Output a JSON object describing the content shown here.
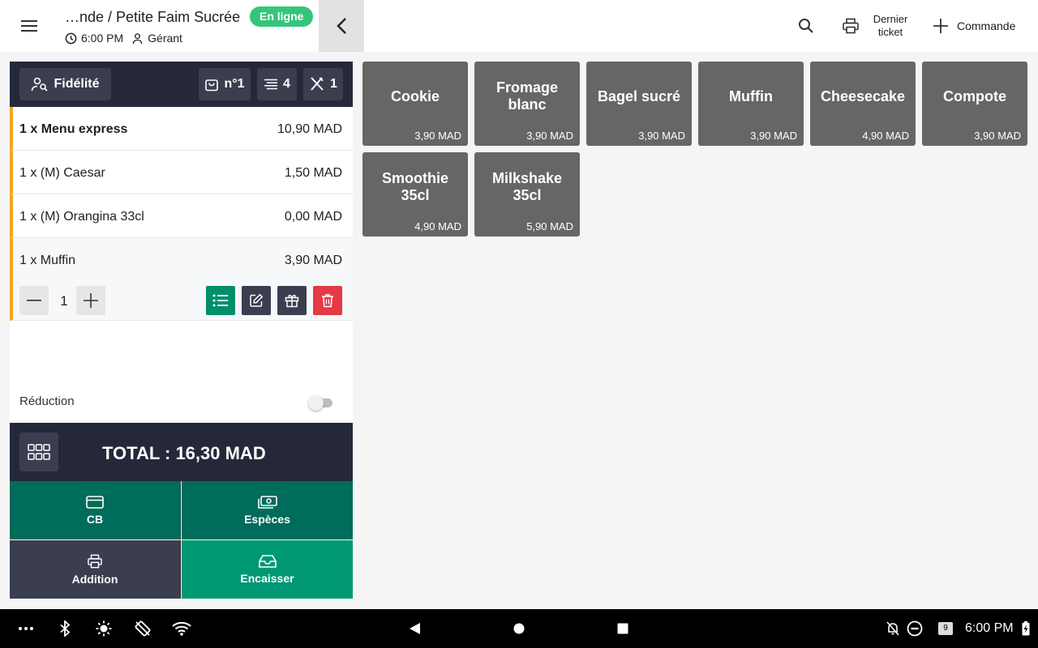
{
  "header": {
    "title": "…nde / Petite Faim Sucrée",
    "status": "En ligne",
    "time": "6:00 PM",
    "user": "Gérant",
    "last_ticket_line1": "Dernier",
    "last_ticket_line2": "ticket",
    "new_order": "Commande"
  },
  "order": {
    "loyalty": "Fidélité",
    "order_number": "n°1",
    "item_count": "4",
    "covers": "1",
    "lines": [
      {
        "name": "1 x Menu express",
        "price": "10,90 MAD"
      },
      {
        "name": "1 x (M) Caesar",
        "price": "1,50 MAD"
      },
      {
        "name": "1 x (M) Orangina 33cl",
        "price": "0,00 MAD"
      },
      {
        "name": "1 x Muffin",
        "price": "3,90 MAD"
      }
    ],
    "selected_qty": "1",
    "discount_label": "Réduction",
    "total": "TOTAL : 16,30 MAD"
  },
  "payment": {
    "card": "CB",
    "cash": "Espèces",
    "bill": "Addition",
    "checkout": "Encaisser"
  },
  "products": [
    {
      "name": "Cookie",
      "price": "3,90 MAD"
    },
    {
      "name": "Fromage blanc",
      "price": "3,90 MAD"
    },
    {
      "name": "Bagel sucré",
      "price": "3,90 MAD"
    },
    {
      "name": "Muffin",
      "price": "3,90 MAD"
    },
    {
      "name": "Cheesecake",
      "price": "4,90 MAD"
    },
    {
      "name": "Compote",
      "price": "3,90 MAD"
    },
    {
      "name": "Smoothie 35cl",
      "price": "4,90 MAD"
    },
    {
      "name": "Milkshake 35cl",
      "price": "5,90 MAD"
    }
  ],
  "system": {
    "clock": "6:00 PM",
    "notification_count": "9"
  },
  "colors": {
    "dark": "#252838",
    "chip": "#3b3e4f",
    "teal": "#008f6b",
    "teal_dark": "#006c5b",
    "accent_orange": "#f5a623",
    "danger": "#e53945",
    "online_green": "#34c57a",
    "tile": "#666666"
  }
}
